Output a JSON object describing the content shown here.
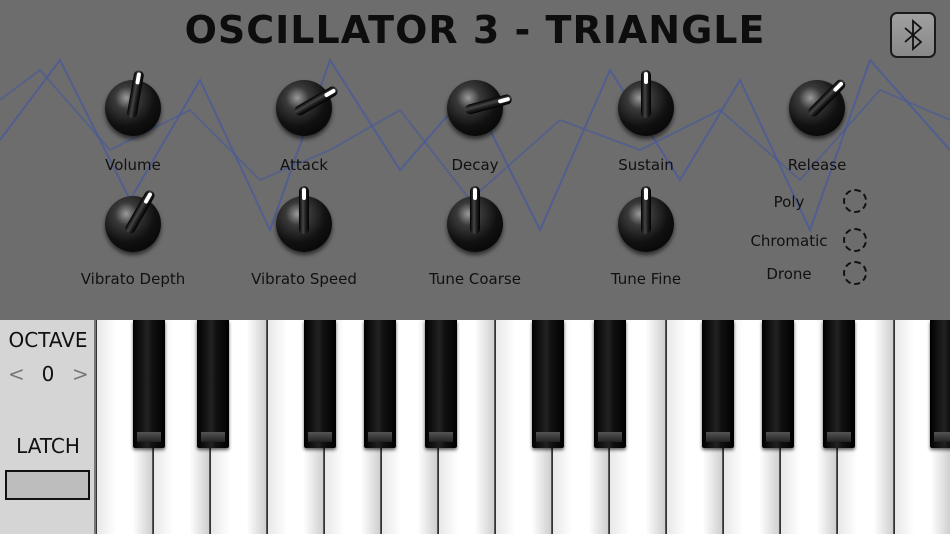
{
  "title": "OSCILLATOR 3 - TRIANGLE",
  "icons": {
    "bluetooth": "bluetooth-icon"
  },
  "knobs": [
    {
      "label": "Volume",
      "angle": 10
    },
    {
      "label": "Attack",
      "angle": 60
    },
    {
      "label": "Decay",
      "angle": 75
    },
    {
      "label": "Sustain",
      "angle": 0
    },
    {
      "label": "Release",
      "angle": 45
    },
    {
      "label": "Vibrato Depth",
      "angle": 30
    },
    {
      "label": "Vibrato Speed",
      "angle": 0
    },
    {
      "label": "Tune Coarse",
      "angle": 0
    },
    {
      "label": "Tune Fine",
      "angle": 0
    }
  ],
  "modes": [
    "Poly",
    "Chromatic",
    "Drone"
  ],
  "octave": {
    "label": "OCTAVE",
    "prev": "<",
    "value": "0",
    "next": ">"
  },
  "latch": {
    "label": "LATCH"
  },
  "colors": {
    "panel": "#6d6d6d",
    "wave": "#4a5a9a"
  }
}
